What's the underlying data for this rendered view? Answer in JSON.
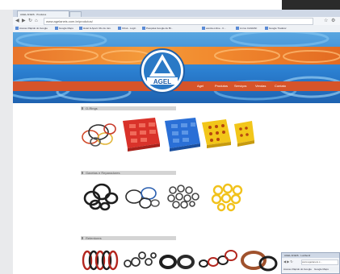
{
  "browser": {
    "tab_title": "AGEL ANEIS · Produtos",
    "url": "www.agelaneis.com.br/produtos/",
    "bookmarks": [
      "Acesso Rápido do Google",
      "Google Maps",
      "Hotel & Apart. Rio de Jan.",
      "Orkut - Login",
      "Pesquisa Google de Bl...",
      "escola online - C...",
      "Livros CAGRAF",
      "Google Tradutor"
    ]
  },
  "site": {
    "logo_text": "AGEL",
    "nav_items": [
      "Agel",
      "Produtos",
      "Serviços",
      "Vendas",
      "Contato"
    ]
  },
  "sections": [
    {
      "title": "O-Rings"
    },
    {
      "title": "Gaxetas e Reparadores"
    },
    {
      "title": "Retentores"
    }
  ],
  "popup": {
    "tab_title": "AGEL ANEIS · Lucibenli",
    "url": "www.agelaneis.c..."
  },
  "colors": {
    "banner_blue": "#2b7fd0",
    "banner_orange": "#f28b2f",
    "nav_red": "#d6542a",
    "kit_red": "#d9322a",
    "kit_blue": "#2a6fd6",
    "kit_yellow": "#f2c61a"
  }
}
